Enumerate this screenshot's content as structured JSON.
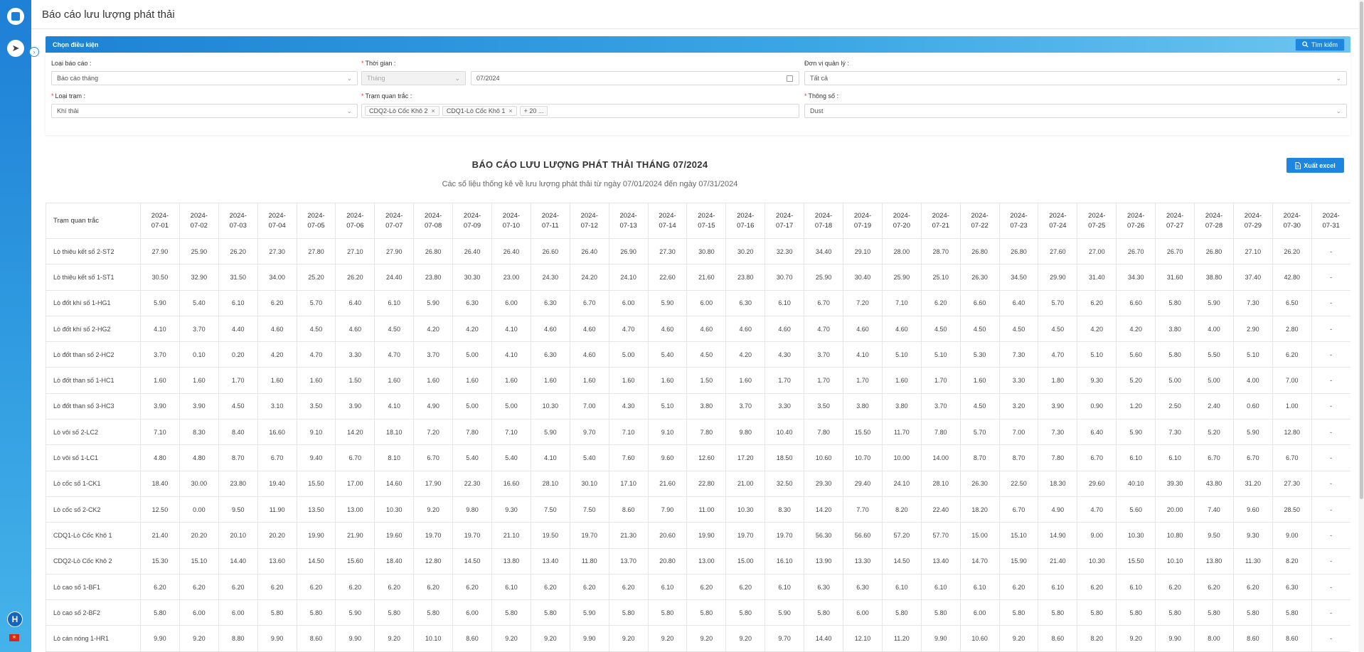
{
  "page": {
    "title": "Báo cáo lưu lượng phát thải"
  },
  "sidebar": {
    "avatar_letter": "H",
    "flag": "★"
  },
  "filter": {
    "header": "Chọn điều kiện",
    "search_label": "Tìm kiếm",
    "report_type": {
      "label": "Loại báo cáo :",
      "value": "Báo cáo tháng"
    },
    "time": {
      "label": "Thời gian :",
      "period": "Tháng",
      "month": "07/2024"
    },
    "unit": {
      "label": "Đơn vị quản lý :",
      "value": "Tất cả"
    },
    "station_type": {
      "label": "Loại trạm :",
      "value": "Khí thải"
    },
    "stations": {
      "label": "Trạm quan trắc :",
      "tags": [
        "CDQ2-Lò Cốc Khô 2",
        "CDQ1-Lò Cốc Khô 1"
      ],
      "more": "+ 20 ..."
    },
    "parameter": {
      "label": "Thông số :",
      "value": "Dust"
    }
  },
  "report": {
    "title": "BÁO CÁO LƯU LƯỢNG PHÁT THẢI THÁNG 07/2024",
    "subtitle": "Các số liệu thống kê về lưu lượng phát thải từ ngày 07/01/2024 đến ngày 07/31/2024",
    "export_label": "Xuất excel"
  },
  "table": {
    "station_header": "Trạm quan trắc",
    "dates": [
      "2024-07-01",
      "2024-07-02",
      "2024-07-03",
      "2024-07-04",
      "2024-07-05",
      "2024-07-06",
      "2024-07-07",
      "2024-07-08",
      "2024-07-09",
      "2024-07-10",
      "2024-07-11",
      "2024-07-12",
      "2024-07-13",
      "2024-07-14",
      "2024-07-15",
      "2024-07-16",
      "2024-07-17",
      "2024-07-18",
      "2024-07-19",
      "2024-07-20",
      "2024-07-21",
      "2024-07-22",
      "2024-07-23",
      "2024-07-24",
      "2024-07-25",
      "2024-07-26",
      "2024-07-27",
      "2024-07-28",
      "2024-07-29",
      "2024-07-30",
      "2024-07-31"
    ],
    "rows": [
      {
        "station": "Lò thiêu kết số 2-ST2",
        "values": [
          "27.90",
          "25.90",
          "26.20",
          "27.30",
          "27.80",
          "27.10",
          "27.90",
          "26.80",
          "26.40",
          "26.40",
          "26.60",
          "26.40",
          "26.90",
          "27.30",
          "30.80",
          "30.20",
          "32.30",
          "34.40",
          "29.10",
          "28.00",
          "28.70",
          "26.80",
          "26.80",
          "27.60",
          "27.00",
          "26.70",
          "26.70",
          "26.80",
          "27.10",
          "26.20",
          "-"
        ]
      },
      {
        "station": "Lò thiêu kết số 1-ST1",
        "values": [
          "30.50",
          "32.90",
          "31.50",
          "34.00",
          "25.20",
          "26.20",
          "24.40",
          "23.80",
          "30.30",
          "23.00",
          "24.30",
          "24.20",
          "24.10",
          "22.60",
          "21.60",
          "23.80",
          "30.70",
          "25.90",
          "30.40",
          "25.90",
          "25.10",
          "26.30",
          "34.50",
          "29.90",
          "31.40",
          "34.30",
          "31.60",
          "38.80",
          "37.40",
          "42.80",
          "-"
        ]
      },
      {
        "station": "Lò đốt khí số 1-HG1",
        "values": [
          "5.90",
          "5.40",
          "6.10",
          "6.20",
          "5.70",
          "6.40",
          "6.10",
          "5.90",
          "6.30",
          "6.00",
          "6.30",
          "6.70",
          "6.00",
          "5.90",
          "6.00",
          "6.30",
          "6.10",
          "6.70",
          "7.20",
          "7.10",
          "6.20",
          "6.60",
          "6.40",
          "5.70",
          "6.20",
          "6.60",
          "5.80",
          "5.90",
          "7.30",
          "6.50",
          "-"
        ]
      },
      {
        "station": "Lò đốt khí số 2-HG2",
        "values": [
          "4.10",
          "3.70",
          "4.40",
          "4.60",
          "4.50",
          "4.60",
          "4.50",
          "4.20",
          "4.20",
          "4.10",
          "4.60",
          "4.60",
          "4.70",
          "4.60",
          "4.60",
          "4.60",
          "4.60",
          "4.70",
          "4.60",
          "4.60",
          "4.50",
          "4.50",
          "4.50",
          "4.50",
          "4.20",
          "4.20",
          "3.80",
          "4.00",
          "2.90",
          "2.80",
          "-"
        ]
      },
      {
        "station": "Lò đốt than số 2-HC2",
        "values": [
          "3.70",
          "0.10",
          "0.20",
          "4.20",
          "4.70",
          "3.30",
          "4.70",
          "3.70",
          "5.00",
          "4.10",
          "6.30",
          "4.60",
          "5.00",
          "5.40",
          "4.50",
          "4.20",
          "4.30",
          "3.70",
          "4.10",
          "5.10",
          "5.10",
          "5.30",
          "7.30",
          "4.70",
          "5.10",
          "5.60",
          "5.80",
          "5.50",
          "5.10",
          "6.20",
          "-"
        ]
      },
      {
        "station": "Lò đốt than số 1-HC1",
        "values": [
          "1.60",
          "1.60",
          "1.70",
          "1.60",
          "1.60",
          "1.50",
          "1.60",
          "1.60",
          "1.60",
          "1.60",
          "1.60",
          "1.60",
          "1.60",
          "1.60",
          "1.50",
          "1.60",
          "1.70",
          "1.70",
          "1.70",
          "1.60",
          "1.70",
          "1.60",
          "3.30",
          "1.80",
          "9.30",
          "5.20",
          "5.00",
          "5.00",
          "4.00",
          "7.00",
          "-"
        ]
      },
      {
        "station": "Lò đốt than số 3-HC3",
        "values": [
          "3.90",
          "3.90",
          "4.50",
          "3.10",
          "3.50",
          "3.90",
          "4.10",
          "4.90",
          "5.00",
          "5.00",
          "10.30",
          "7.00",
          "4.30",
          "5.10",
          "3.80",
          "3.70",
          "3.30",
          "3.50",
          "3.80",
          "3.80",
          "3.70",
          "4.50",
          "3.20",
          "3.90",
          "0.90",
          "1.20",
          "2.50",
          "2.40",
          "0.60",
          "1.00",
          "-"
        ]
      },
      {
        "station": "Lò vôi số 2-LC2",
        "values": [
          "7.10",
          "8.30",
          "8.40",
          "16.60",
          "9.10",
          "14.20",
          "18.10",
          "7.20",
          "7.80",
          "7.10",
          "5.90",
          "9.70",
          "7.10",
          "9.10",
          "7.80",
          "9.80",
          "10.40",
          "7.80",
          "15.50",
          "11.70",
          "7.80",
          "5.70",
          "7.00",
          "7.30",
          "6.40",
          "5.90",
          "7.30",
          "5.20",
          "5.90",
          "12.80",
          "-"
        ]
      },
      {
        "station": "Lò vôi số 1-LC1",
        "values": [
          "4.80",
          "4.80",
          "8.70",
          "6.70",
          "9.40",
          "6.70",
          "8.10",
          "6.70",
          "5.40",
          "5.40",
          "4.10",
          "5.40",
          "7.60",
          "9.60",
          "12.60",
          "17.20",
          "18.50",
          "10.60",
          "10.70",
          "10.00",
          "14.00",
          "8.70",
          "8.70",
          "7.80",
          "6.70",
          "6.10",
          "6.10",
          "6.70",
          "6.70",
          "6.70",
          "-"
        ]
      },
      {
        "station": "Lò cốc số 1-CK1",
        "values": [
          "18.40",
          "30.00",
          "23.80",
          "19.40",
          "15.50",
          "17.00",
          "14.60",
          "17.90",
          "22.30",
          "16.60",
          "28.10",
          "30.10",
          "17.10",
          "21.60",
          "22.80",
          "21.00",
          "32.50",
          "29.30",
          "29.40",
          "24.10",
          "28.10",
          "26.30",
          "22.50",
          "18.30",
          "29.60",
          "40.10",
          "39.30",
          "43.80",
          "31.20",
          "27.30",
          "-"
        ]
      },
      {
        "station": "Lò cốc số 2-CK2",
        "values": [
          "12.50",
          "0.00",
          "9.50",
          "11.90",
          "13.50",
          "13.00",
          "10.30",
          "9.20",
          "9.80",
          "9.30",
          "7.50",
          "7.50",
          "8.60",
          "7.90",
          "11.00",
          "10.30",
          "8.30",
          "14.20",
          "7.70",
          "8.20",
          "22.40",
          "18.20",
          "6.70",
          "4.90",
          "4.70",
          "5.60",
          "20.00",
          "7.40",
          "9.60",
          "28.50",
          "-"
        ]
      },
      {
        "station": "CDQ1-Lò Cốc Khô 1",
        "values": [
          "21.40",
          "20.20",
          "20.10",
          "20.20",
          "19.90",
          "21.90",
          "19.60",
          "19.70",
          "19.70",
          "21.10",
          "19.50",
          "19.70",
          "21.30",
          "20.60",
          "19.90",
          "19.70",
          "19.70",
          "56.30",
          "56.60",
          "57.20",
          "57.70",
          "15.00",
          "15.10",
          "14.90",
          "9.00",
          "10.30",
          "10.80",
          "9.50",
          "9.30",
          "9.00",
          "-"
        ]
      },
      {
        "station": "CDQ2-Lò Cốc Khô 2",
        "values": [
          "15.30",
          "15.10",
          "14.40",
          "13.60",
          "14.50",
          "15.60",
          "18.40",
          "12.80",
          "14.50",
          "13.80",
          "13.40",
          "11.80",
          "13.70",
          "20.80",
          "13.00",
          "15.00",
          "16.10",
          "13.90",
          "13.30",
          "14.50",
          "13.40",
          "14.70",
          "15.90",
          "21.40",
          "10.30",
          "15.50",
          "10.10",
          "13.80",
          "11.30",
          "8.20",
          "-"
        ]
      },
      {
        "station": "Lò cao số 1-BF1",
        "values": [
          "6.20",
          "6.20",
          "6.20",
          "6.20",
          "6.20",
          "6.20",
          "6.20",
          "6.20",
          "6.20",
          "6.10",
          "6.20",
          "6.20",
          "6.20",
          "6.10",
          "6.20",
          "6.20",
          "6.10",
          "6.30",
          "6.30",
          "6.10",
          "6.10",
          "6.10",
          "6.20",
          "6.10",
          "6.20",
          "6.10",
          "6.20",
          "6.20",
          "6.20",
          "6.30",
          "-"
        ]
      },
      {
        "station": "Lò cao số 2-BF2",
        "values": [
          "5.80",
          "6.00",
          "6.00",
          "5.80",
          "5.80",
          "5.90",
          "5.80",
          "5.80",
          "6.00",
          "5.80",
          "5.80",
          "5.90",
          "5.80",
          "5.80",
          "5.80",
          "5.80",
          "5.90",
          "5.80",
          "6.00",
          "5.80",
          "5.80",
          "6.00",
          "5.80",
          "5.80",
          "5.80",
          "5.80",
          "5.80",
          "5.80",
          "5.80",
          "5.80",
          "-"
        ]
      },
      {
        "station": "Lò cán nóng 1-HR1",
        "values": [
          "9.90",
          "9.20",
          "8.80",
          "9.90",
          "8.60",
          "9.90",
          "9.20",
          "10.10",
          "8.60",
          "9.20",
          "9.20",
          "9.90",
          "9.20",
          "9.20",
          "9.20",
          "9.20",
          "9.70",
          "14.40",
          "12.10",
          "11.20",
          "9.90",
          "10.60",
          "9.20",
          "8.60",
          "8.20",
          "9.20",
          "9.90",
          "8.00",
          "8.60",
          "8.60",
          "-"
        ]
      }
    ]
  }
}
